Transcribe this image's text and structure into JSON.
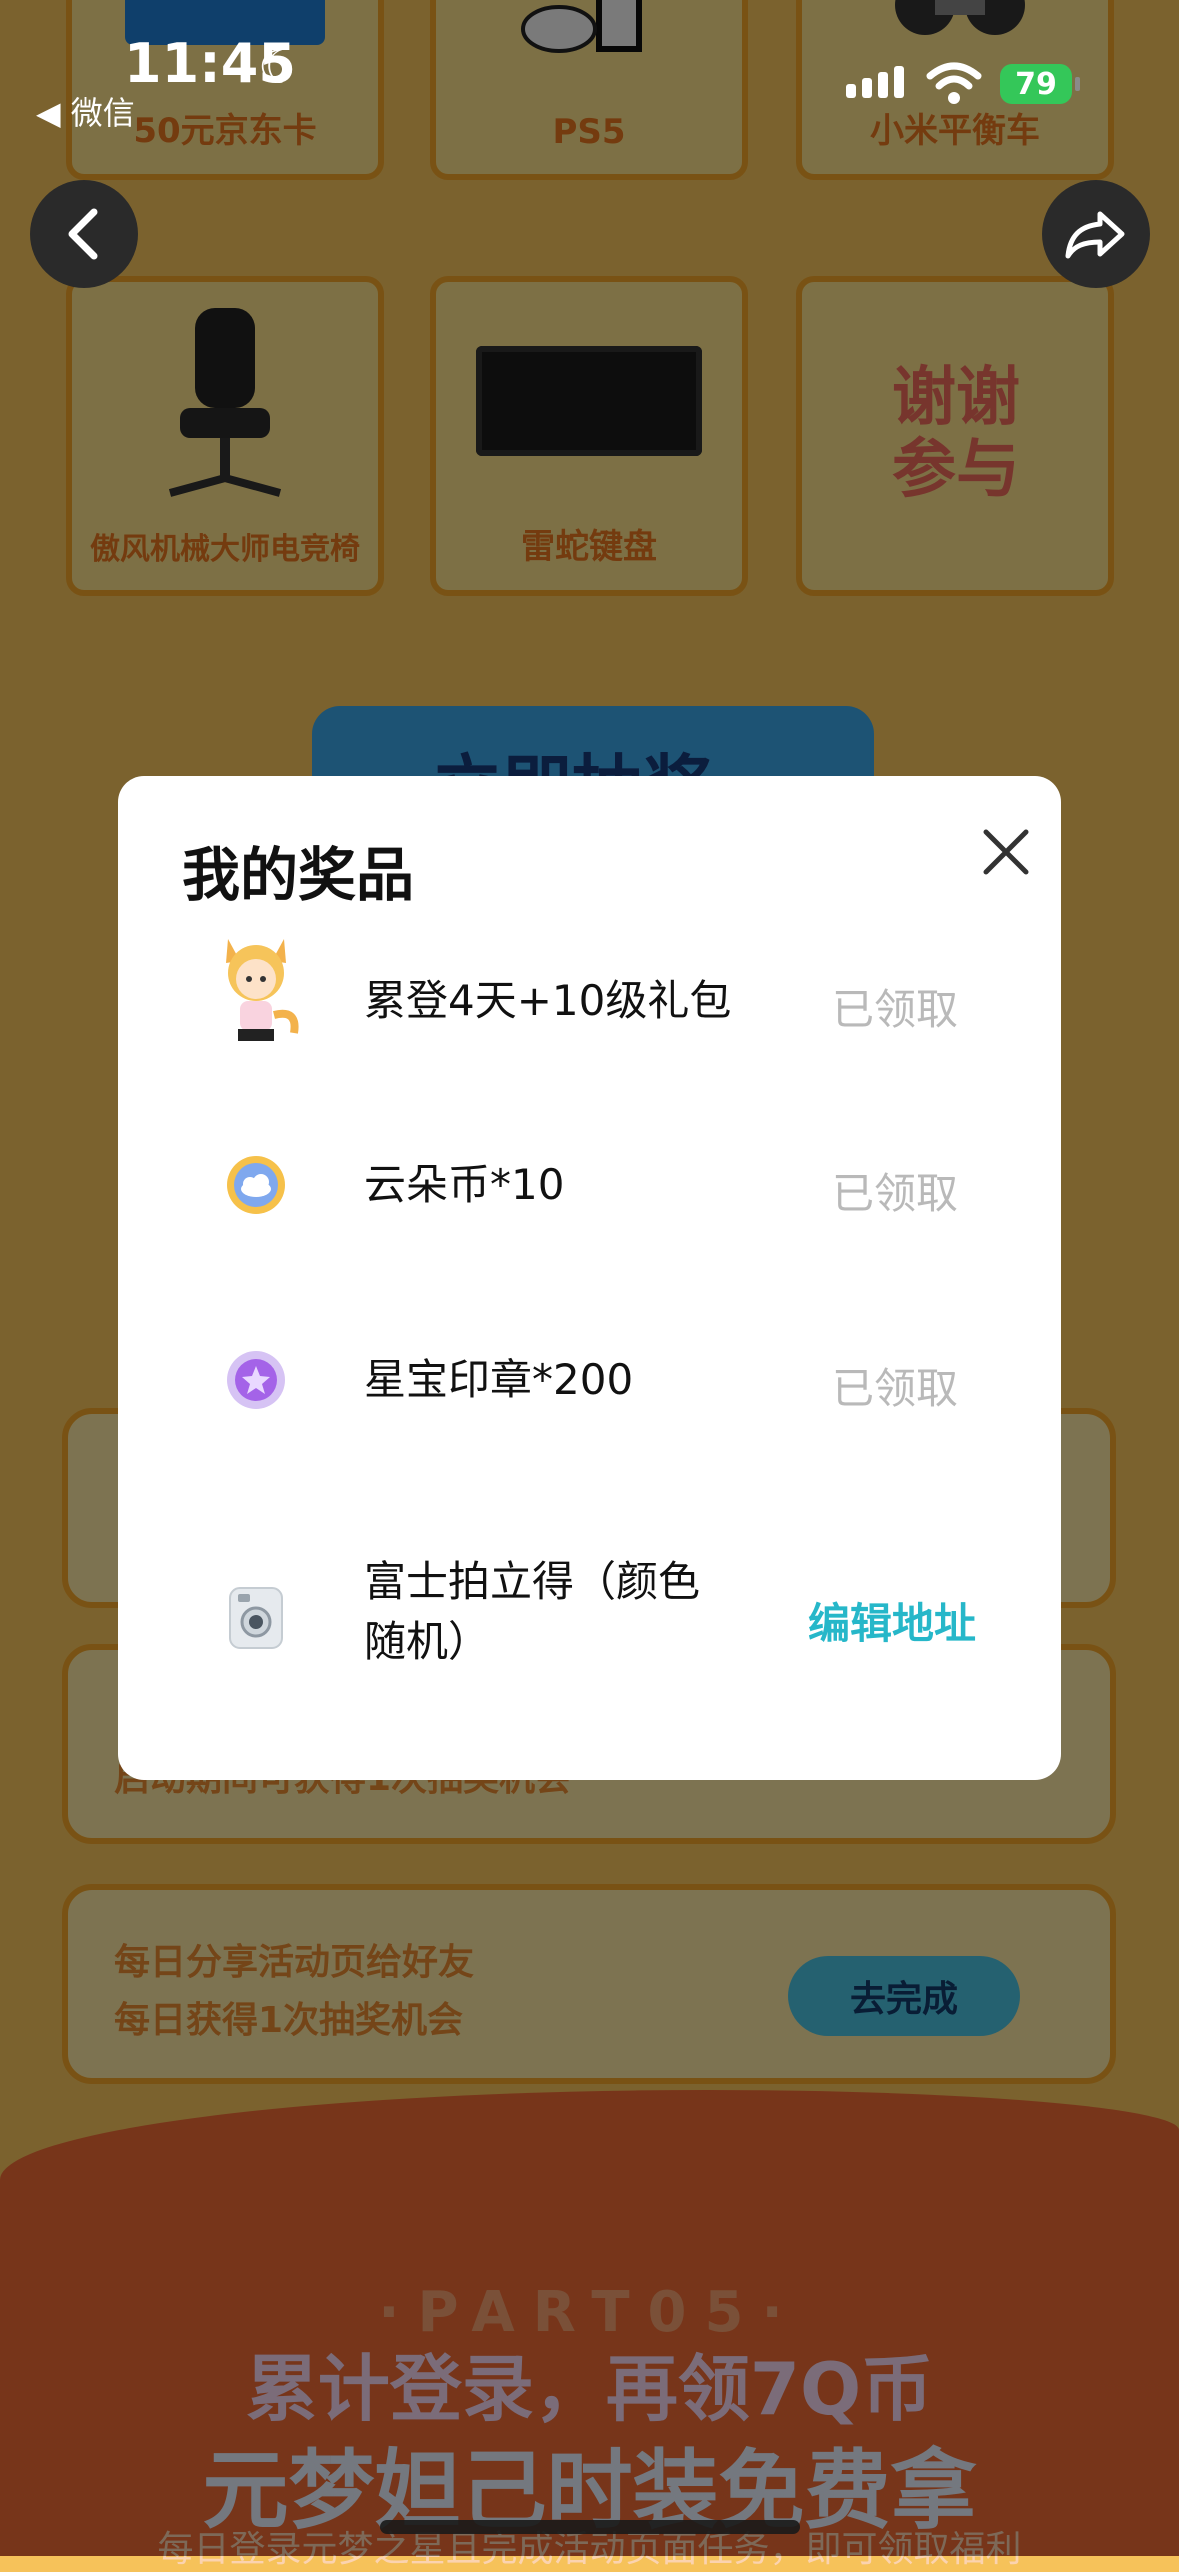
{
  "status_bar": {
    "time": "11:45",
    "back_app": "◀ 微信",
    "battery": "79"
  },
  "background": {
    "prizes_top": [
      "50元京东卡",
      "PS5",
      "小米平衡车"
    ],
    "prizes_mid": [
      "傲风机械大师电竞椅",
      "雷蛇键盘",
      "谢谢参与"
    ],
    "thanks_line1": "谢谢",
    "thanks_line2": "参与",
    "draw_button": "立即抽奖",
    "tasks": [
      {
        "text1": "",
        "text2": "",
        "button": ""
      },
      {
        "text1": "",
        "text2": "启动期间可获得1次抽奖机会",
        "button": ""
      },
      {
        "text1": "每日分享活动页给好友",
        "text2": "每日获得1次抽奖机会",
        "button": "去完成"
      }
    ],
    "part_label": "·PART05·",
    "promo_line1": "累计登录，再领7Q币",
    "promo_line2": "元梦妲己时装免费拿",
    "promo_sub": "每日登录元梦之星且完成活动页面任务，即可领取福利"
  },
  "modal": {
    "title": "我的奖品",
    "items": [
      {
        "name": "累登4天+10级礼包",
        "status": "已领取",
        "icon": "character-gift-icon"
      },
      {
        "name": "云朵币*10",
        "status": "已领取",
        "icon": "cloud-coin-icon"
      },
      {
        "name": "星宝印章*200",
        "status": "已领取",
        "icon": "star-stamp-icon"
      },
      {
        "name_line1": "富士拍立得（颜色",
        "name_line2": "随机）",
        "action": "编辑地址",
        "icon": "instant-camera-icon"
      }
    ]
  },
  "colors": {
    "accent": "#26b7c9",
    "claimed_gray": "#b9b9b9",
    "battery_green": "#34c759"
  }
}
